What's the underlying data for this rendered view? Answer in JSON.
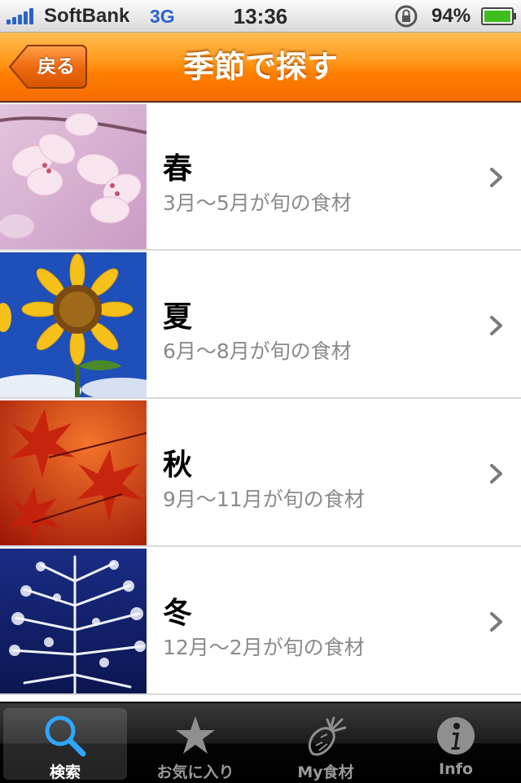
{
  "status_bar": {
    "carrier": "SoftBank",
    "network": "3G",
    "time": "13:36",
    "battery_percent": "94%",
    "icons": [
      "signal-icon",
      "rotation-lock-icon",
      "battery-icon"
    ]
  },
  "nav": {
    "back_label": "戻る",
    "title": "季節で探す",
    "accent_color": "#ff8a00"
  },
  "seasons": [
    {
      "title": "春",
      "subtitle": "3月～5月が旬の食材",
      "image": "cherry-blossom"
    },
    {
      "title": "夏",
      "subtitle": "6月～8月が旬の食材",
      "image": "sunflower"
    },
    {
      "title": "秋",
      "subtitle": "9月～11月が旬の食材",
      "image": "autumn-maple-leaves"
    },
    {
      "title": "冬",
      "subtitle": "12月～2月が旬の食材",
      "image": "frosted-tree"
    }
  ],
  "tabs": [
    {
      "label": "検索",
      "icon": "search-icon",
      "selected": true
    },
    {
      "label": "お気に入り",
      "icon": "star-icon",
      "selected": false
    },
    {
      "label": "My食材",
      "icon": "vegetable-icon",
      "selected": false
    },
    {
      "label": "Info",
      "icon": "info-icon",
      "selected": false
    }
  ]
}
